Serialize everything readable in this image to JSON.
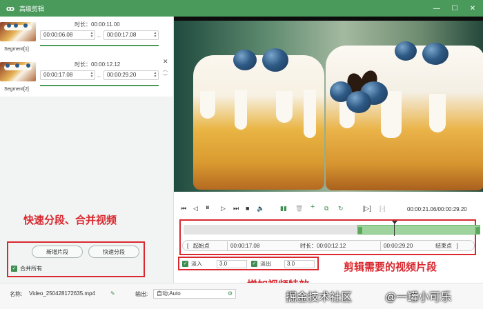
{
  "window": {
    "title": "高级剪辑"
  },
  "segments": [
    {
      "label": "Segment[1]",
      "duration_label": "时长：00:00:11.00",
      "start": "00:00:06.08",
      "end": "00:00:17.08"
    },
    {
      "label": "Segment[2]",
      "duration_label": "时长：00:00:12.12",
      "start": "00:00:17.08",
      "end": "00:00:29.20"
    }
  ],
  "left_panel": {
    "add_segment": "新增片段",
    "quick_split": "快速分段",
    "merge_all": "合并所有"
  },
  "annotations": {
    "left": "快速分段、合并视频",
    "timeline": "剪辑需要的视频片段",
    "fade": "增加视频特效"
  },
  "player": {
    "timecode": "00:00:21.06/00:00:29.20"
  },
  "timeline": {
    "start_button": "起始点",
    "start_value": "00:00:17.08",
    "duration_label": "时长：00:00:12.12",
    "end_value": "00:00:29.20",
    "end_button": "结束点",
    "bracket_left": "[",
    "bracket_right": "]"
  },
  "effects": {
    "fade_in_label": "淡入",
    "fade_in_value": "3.0",
    "fade_out_label": "淡出",
    "fade_out_value": "3.0"
  },
  "bottom_bar": {
    "name_label": "名称:",
    "name_value": "Video_250428172635.mp4",
    "output_label": "输出:",
    "output_value": "自动;Auto"
  },
  "watermark": {
    "left": "掘金技术社区",
    "right": "@一罐小可乐"
  },
  "colors": {
    "accent": "#4a9a5c",
    "annotation": "#d9282f"
  }
}
